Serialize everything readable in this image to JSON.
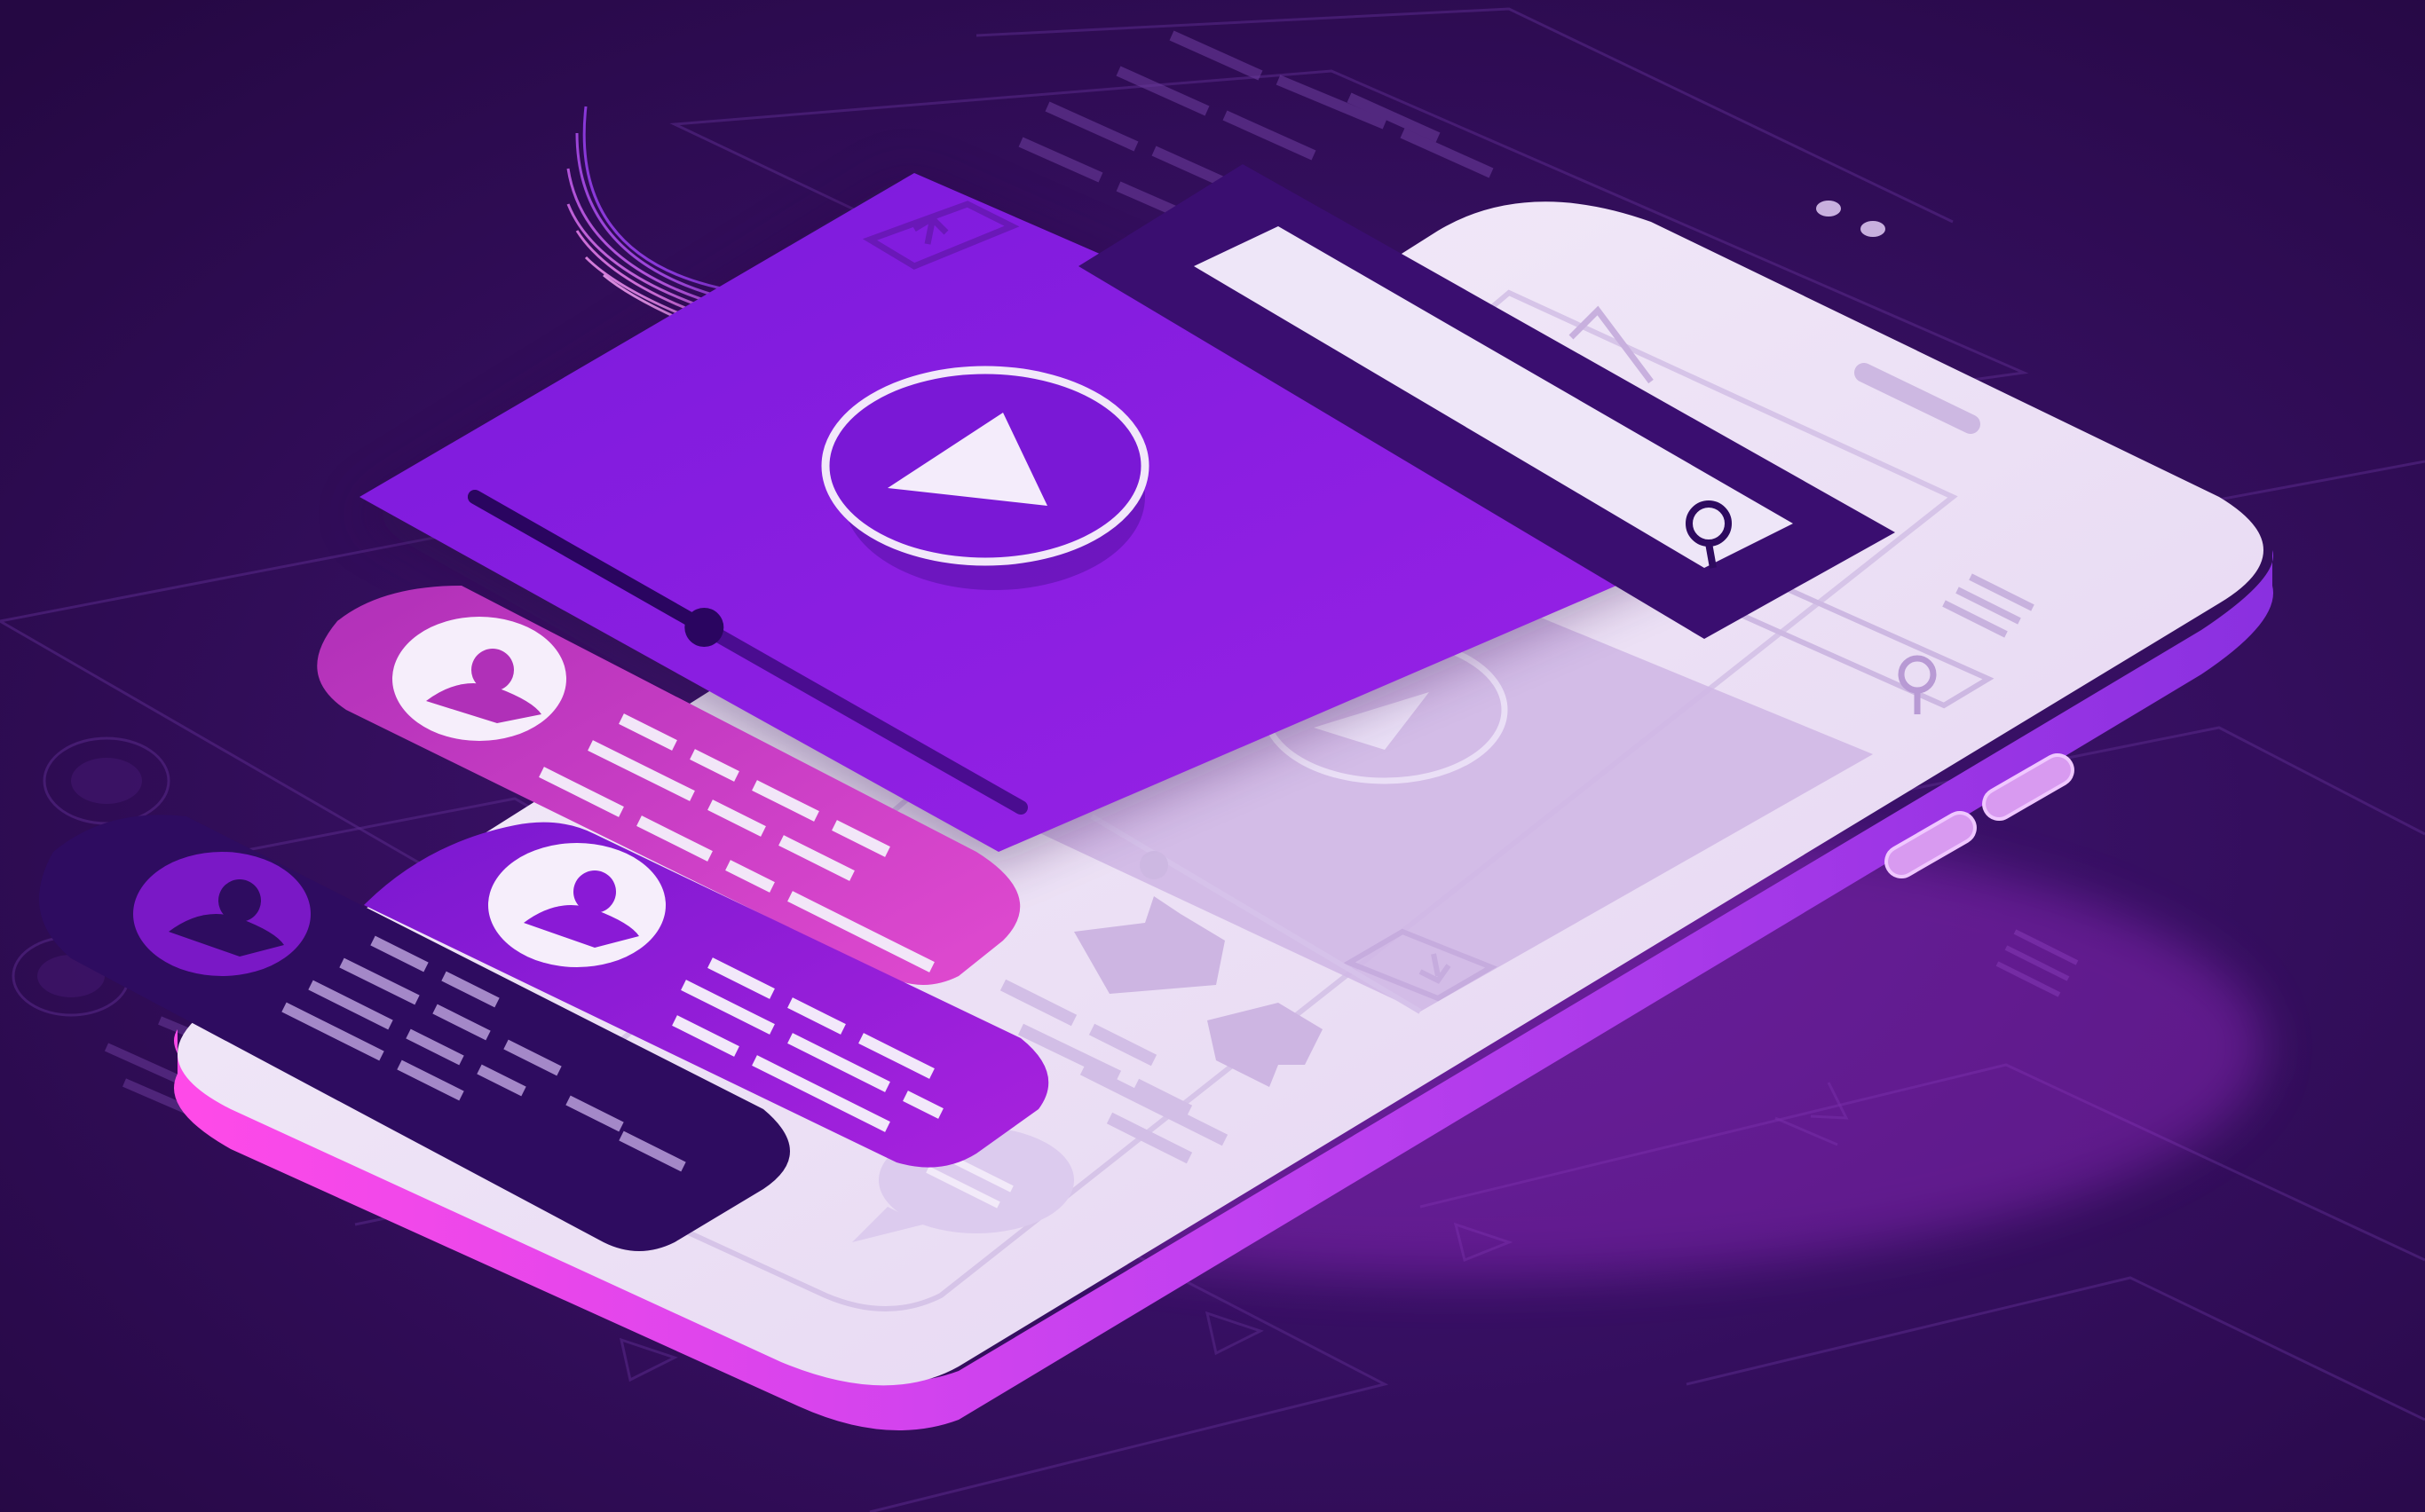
{
  "scene": {
    "description_tag": "isometric-mobile-video-app-illustration",
    "colors": {
      "background_top": "#2a0a4a",
      "background_bottom": "#3a0f66",
      "phone_body": "#ebe0f4",
      "phone_edge": "#c050e8",
      "video_card": "#8a1ee0",
      "search_card": "#3a0e70",
      "comment_pink": "#c03ac0",
      "comment_purple": "#8a1ad6",
      "comment_dark": "#2e0c60",
      "accent_light": "#f0e6fa"
    }
  },
  "icons": [
    "play-icon",
    "search-icon",
    "upload-icon",
    "download-icon",
    "thumbs-up-icon",
    "thumbs-down-icon",
    "comment-bubble-icon",
    "user-avatar-icon",
    "menu-icon",
    "caret-up-icon"
  ],
  "video_player": {
    "progress": 0.42
  },
  "comments": {
    "count": 3
  }
}
